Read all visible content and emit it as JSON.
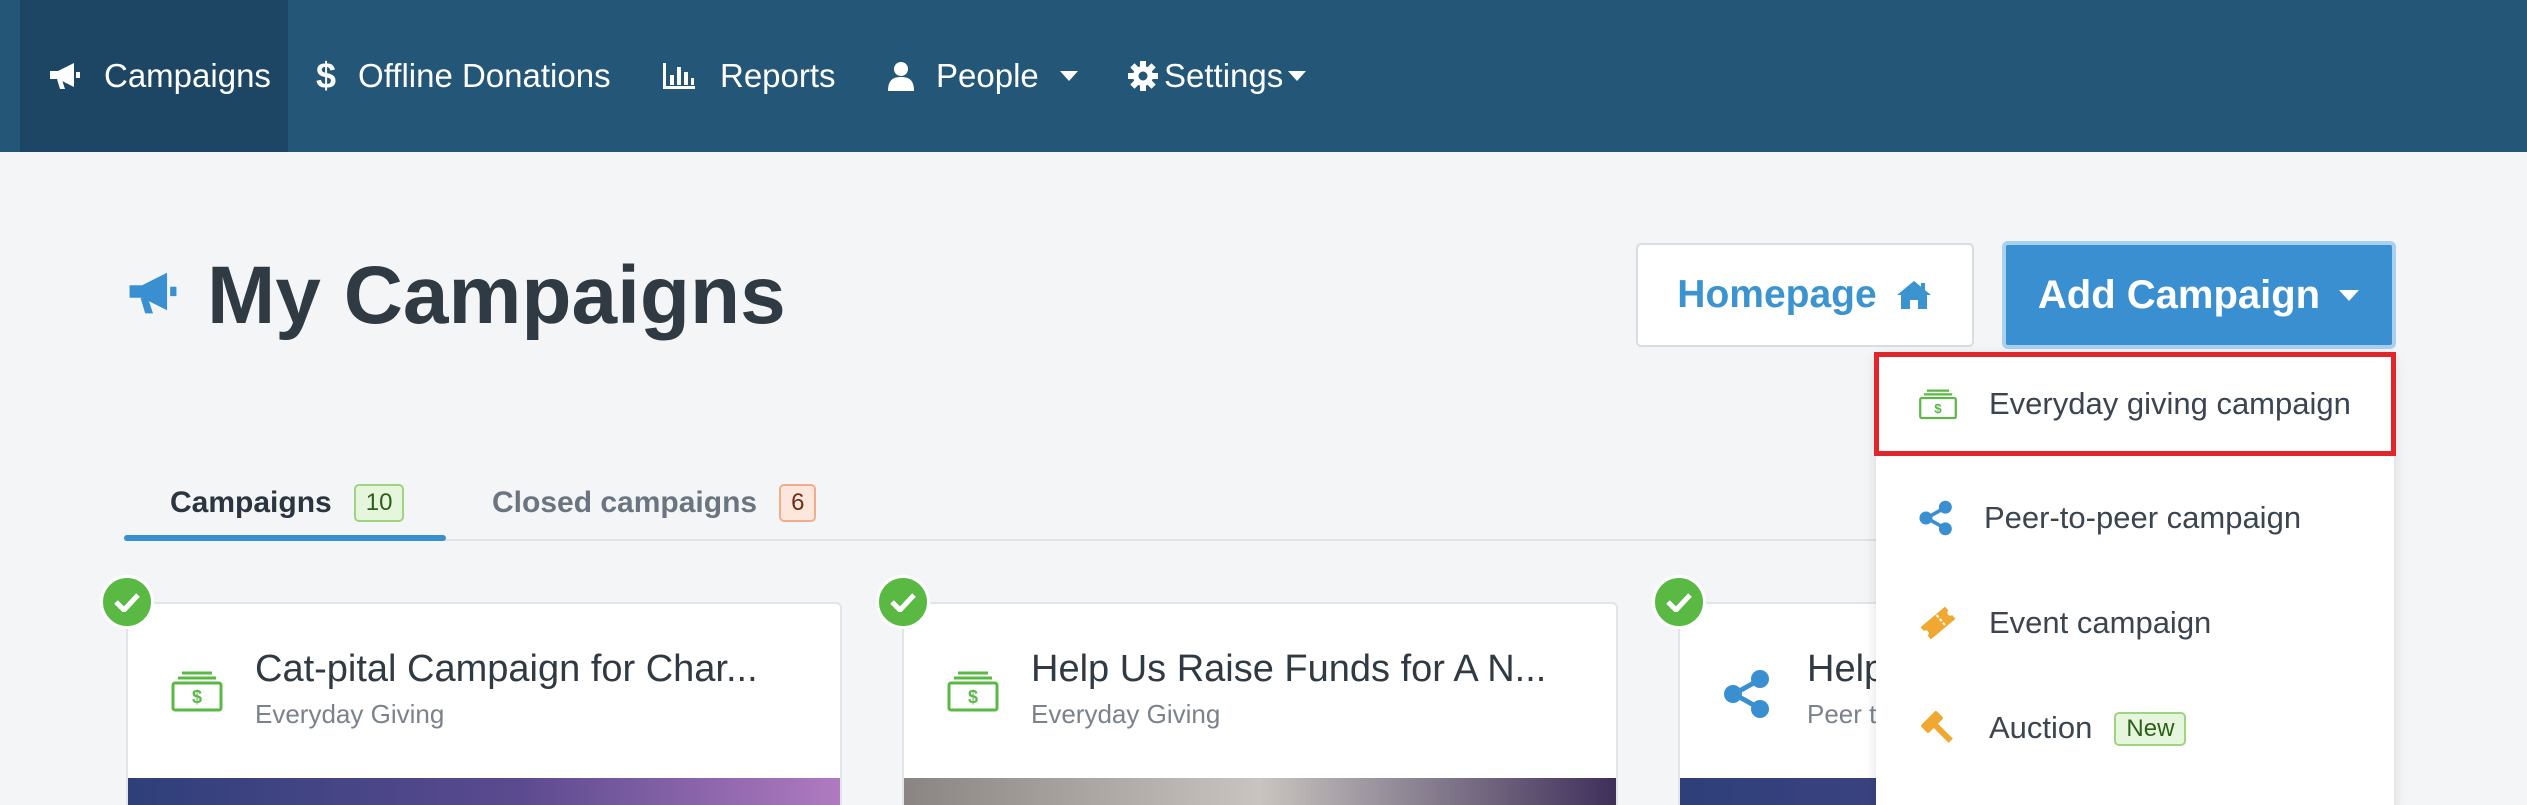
{
  "nav": {
    "items": [
      {
        "label": "Campaigns",
        "icon": "megaphone-icon",
        "active": true
      },
      {
        "label": "Offline Donations",
        "icon": "dollar-icon"
      },
      {
        "label": "Reports",
        "icon": "bar-chart-icon"
      },
      {
        "label": "People",
        "icon": "user-icon",
        "caret": true
      },
      {
        "label": "Settings",
        "icon": "gear-icon",
        "caret": true
      }
    ]
  },
  "header": {
    "title": "My Campaigns",
    "homepage_label": "Homepage",
    "add_campaign_label": "Add Campaign"
  },
  "tabs": [
    {
      "label": "Campaigns",
      "count": "10"
    },
    {
      "label": "Closed campaigns",
      "count": "6"
    }
  ],
  "cards": [
    {
      "title": "Cat-pital Campaign for Char...",
      "type": "Everyday Giving"
    },
    {
      "title": "Help Us Raise Funds for A N...",
      "type": "Everyday Giving"
    },
    {
      "title": "Help",
      "type": "Peer to"
    }
  ],
  "dropdown": {
    "items": [
      {
        "label": "Everyday giving campaign",
        "icon": "cash-icon"
      },
      {
        "label": "Peer-to-peer campaign",
        "icon": "share-icon"
      },
      {
        "label": "Event campaign",
        "icon": "ticket-icon"
      },
      {
        "label": "Auction",
        "icon": "gavel-icon",
        "badge": "New"
      }
    ]
  },
  "colors": {
    "nav_bg": "#245677",
    "primary": "#3a8fd1",
    "success": "#59b943",
    "highlight": "#e0262b"
  }
}
